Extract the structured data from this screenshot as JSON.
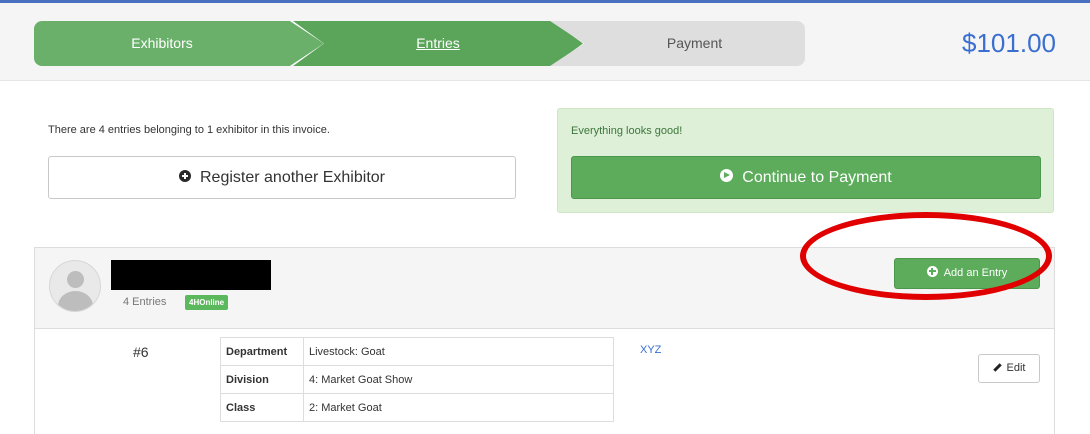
{
  "steps": [
    {
      "label": "Exhibitors",
      "state": "done"
    },
    {
      "label": "Entries",
      "state": "current"
    },
    {
      "label": "Payment",
      "state": "pending"
    }
  ],
  "total": "$101.00",
  "summary": {
    "text": "There are 4 entries belonging to 1 exhibitor in this invoice.",
    "register_button": "Register another Exhibitor"
  },
  "status_panel": {
    "message": "Everything looks good!",
    "continue_button": "Continue to Payment"
  },
  "exhibitor": {
    "entries_count": "4 Entries",
    "badge": "4HOnline",
    "add_entry_button": "Add an Entry"
  },
  "entry": {
    "number": "#6",
    "details": [
      {
        "key": "Department",
        "value": "Livestock: Goat"
      },
      {
        "key": "Division",
        "value": "4: Market Goat Show"
      },
      {
        "key": "Class",
        "value": "2: Market Goat"
      }
    ],
    "link": "XYZ",
    "edit_button": "Edit"
  },
  "colors": {
    "step_active": "#6ab06a",
    "step_inactive": "#dedede",
    "total": "#3a6fcf",
    "success_bg": "#dff0d8",
    "button_green": "#5cac5c",
    "annotation": "#e00000"
  }
}
